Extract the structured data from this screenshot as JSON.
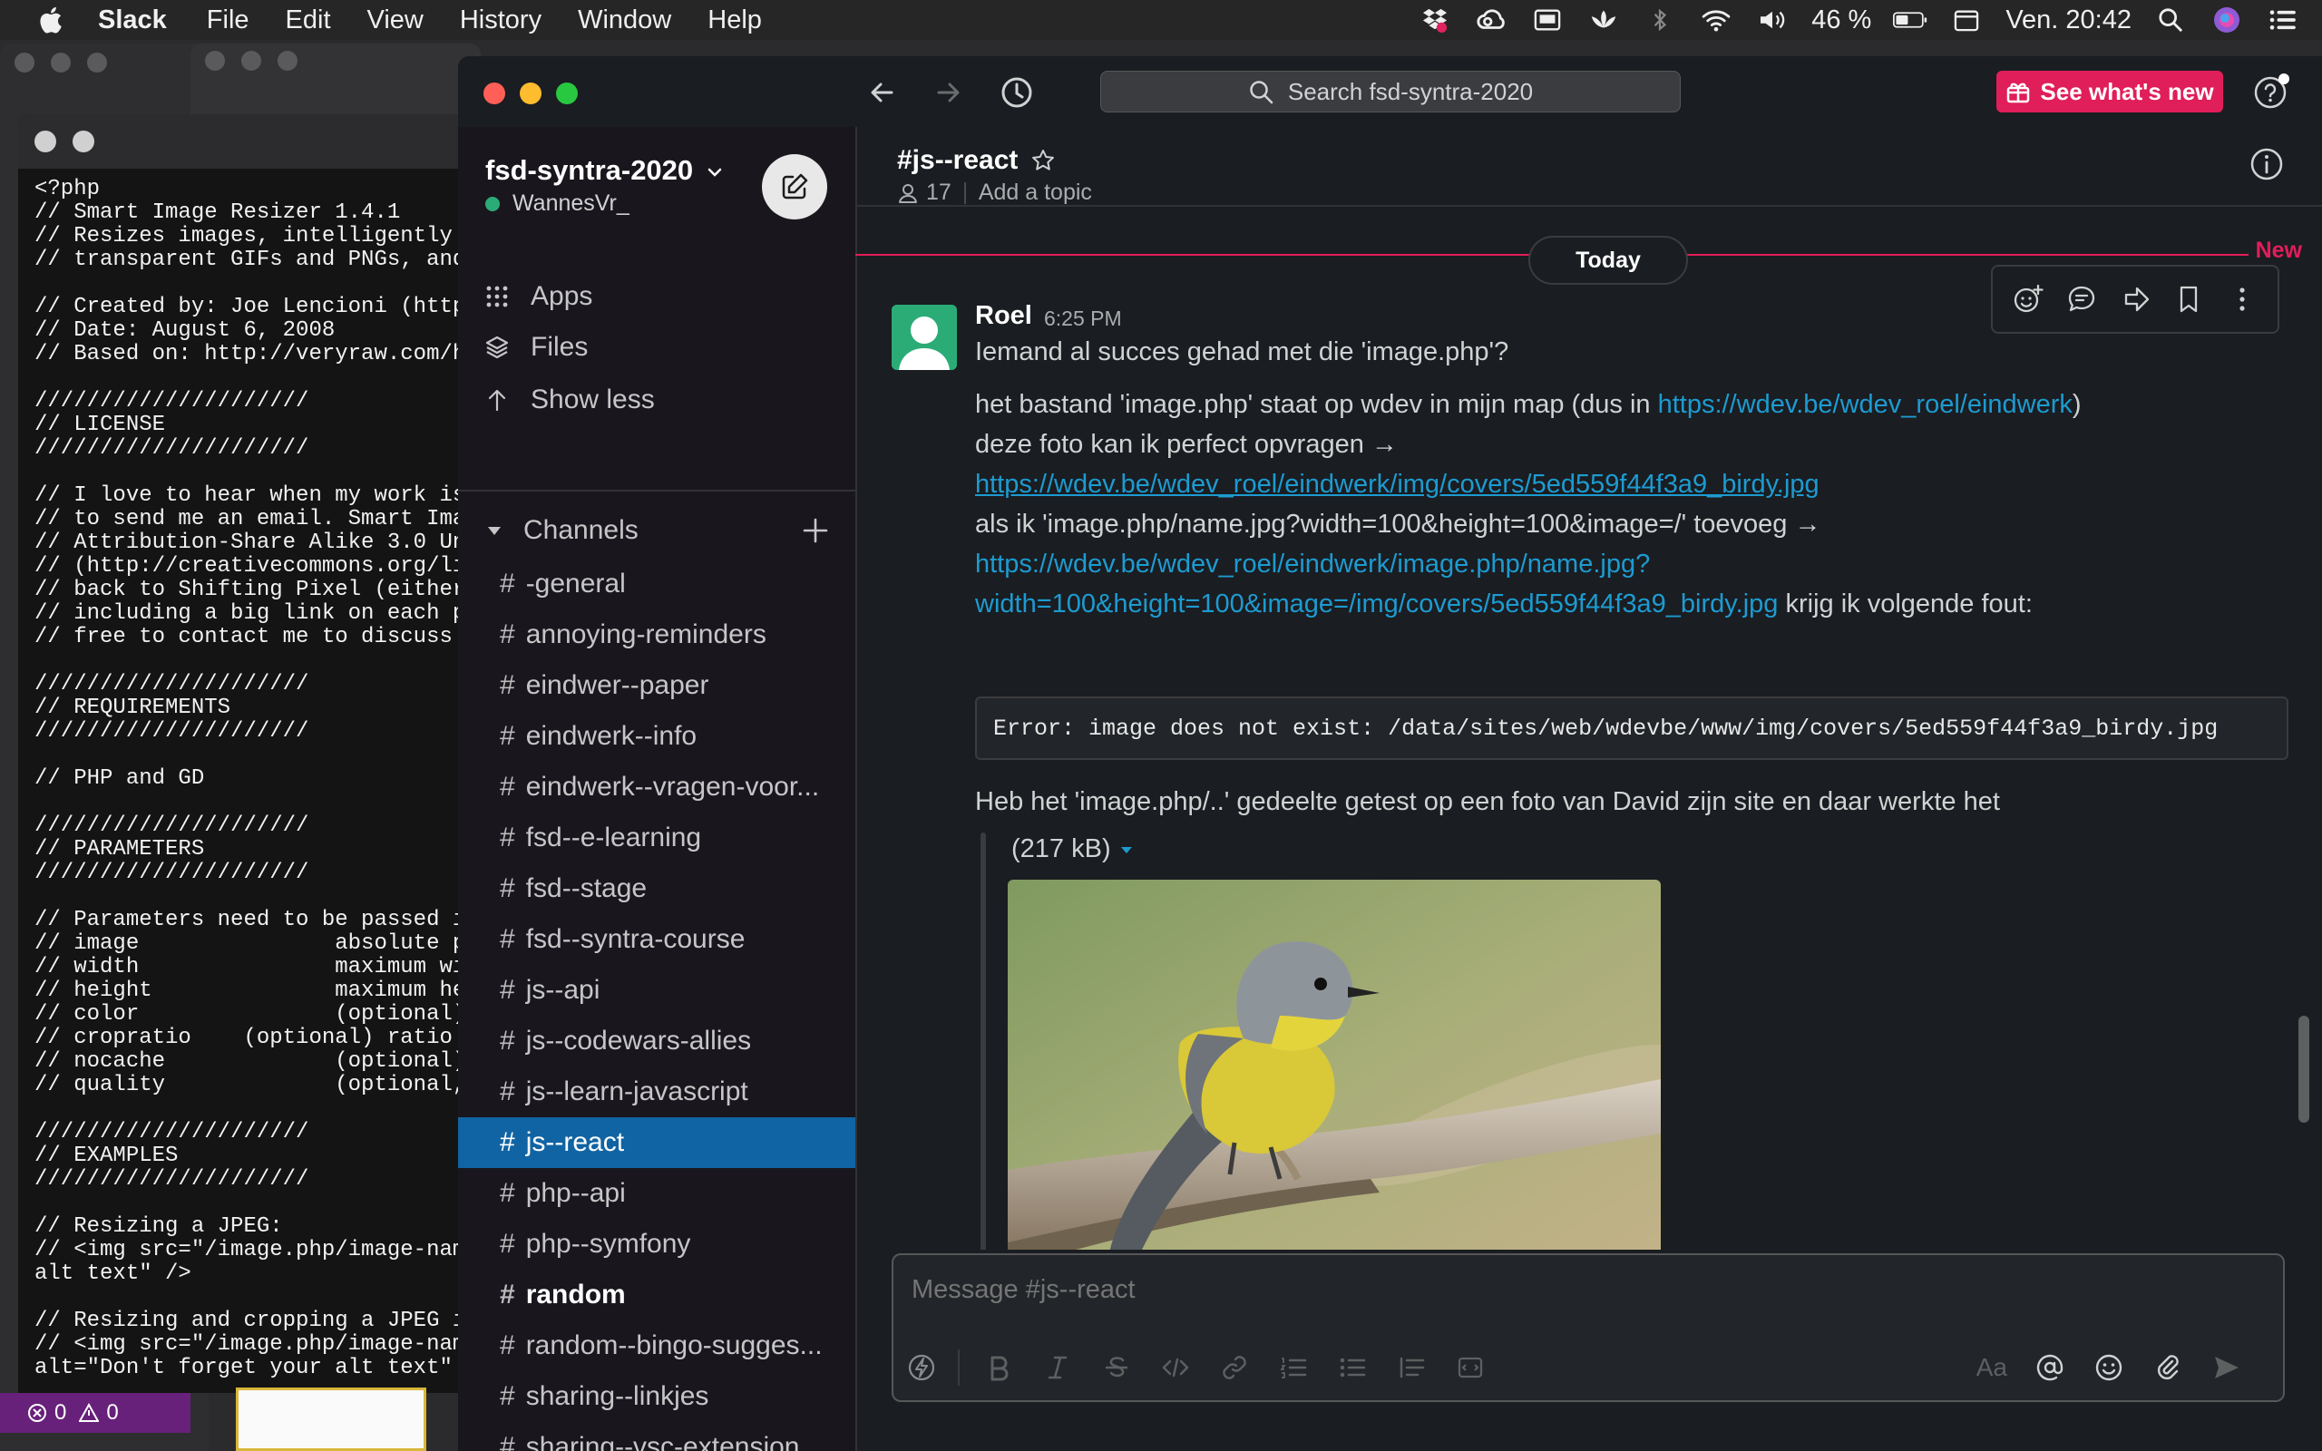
{
  "menubar": {
    "app_name": "Slack",
    "items": [
      "File",
      "Edit",
      "View",
      "History",
      "Window",
      "Help"
    ],
    "battery": "46 %",
    "clock": "Ven. 20:42"
  },
  "code_editor": {
    "code": "<?php\n// Smart Image Resizer 1.4.1\n// Resizes images, intelligently sh\n// transparent GIFs and PNGs, and c\n\n// Created by: Joe Lencioni (http:/\n// Date: August 6, 2008\n// Based on: http://veryraw.com/his\n\n/////////////////////\n// LICENSE\n/////////////////////\n\n// I love to hear when my work is b\n// to send me an email. Smart Image\n// Attribution-Share Alike 3.0 Unit\n// (http://creativecommons.org/lice\n// back to Shifting Pixel (either t\n// including a big link on each pag\n// free to contact me to discuss an\n\n/////////////////////\n// REQUIREMENTS\n/////////////////////\n\n// PHP and GD\n\n/////////////////////\n// PARAMETERS\n/////////////////////\n\n// Parameters need to be passed in \n// image               absolute pa\n// width               maximum wid\n// height              maximum hei\n// color               (optional) \n// cropratio    (optional) ratio of\n// nocache             (optional) \n// quality             (optional, \n\n/////////////////////\n// EXAMPLES\n/////////////////////\n\n// Resizing a JPEG:\n// <img src=\"/image.php/image-name.\nalt text\" />\n\n// Resizing and cropping a JPEG int\n// <img src=\"/image.php/image-name.\nalt=\"Don't forget your alt text\" />",
    "status_errors": "0",
    "status_warnings": "0"
  },
  "toolbar": {
    "search_placeholder": "Search fsd-syntra-2020",
    "whats_new_label": "See what's new"
  },
  "sidebar": {
    "workspace_name": "fsd-syntra-2020",
    "user_name": "WannesVr_",
    "links": [
      {
        "label": "Apps",
        "icon": "apps-grid-icon"
      },
      {
        "label": "Files",
        "icon": "files-layers-icon"
      },
      {
        "label": "Show less",
        "icon": "arrow-up-icon"
      }
    ],
    "channels_label": "Channels",
    "channels": [
      {
        "name": "-general"
      },
      {
        "name": "annoying-reminders"
      },
      {
        "name": "eindwer--paper"
      },
      {
        "name": "eindwerk--info"
      },
      {
        "name": "eindwerk--vragen-voor..."
      },
      {
        "name": "fsd--e-learning"
      },
      {
        "name": "fsd--stage"
      },
      {
        "name": "fsd--syntra-course"
      },
      {
        "name": "js--api"
      },
      {
        "name": "js--codewars-allies"
      },
      {
        "name": "js--learn-javascript"
      },
      {
        "name": "js--react",
        "active": true
      },
      {
        "name": "php--api"
      },
      {
        "name": "php--symfony"
      },
      {
        "name": "random",
        "bold": true
      },
      {
        "name": "random--bingo-sugges..."
      },
      {
        "name": "sharing--linkjes"
      },
      {
        "name": "sharing--vsc-extension"
      }
    ]
  },
  "channel": {
    "name": "#js--react",
    "member_count": "17",
    "topic_placeholder": "Add a topic"
  },
  "messages": {
    "new_label": "New",
    "date_divider": "Today",
    "sender": "Roel",
    "time": "6:25 PM",
    "line1": "Iemand al succes gehad met die 'image.php'?",
    "line2_text": "het bastand 'image.php' staat op wdev in mijn map (dus in ",
    "line2_link": "https://wdev.be/wdev_roel/eindwerk",
    "line2_end": ")",
    "line3": "deze foto kan ik perfect opvragen →",
    "line4_link": "https://wdev.be/wdev_roel/eindwerk/img/covers/5ed559f44f3a9_birdy.jpg",
    "line5": "als ik 'image.php/name.jpg?width=100&height=100&image=/' toevoeg →",
    "line6_link": "https://wdev.be/wdev_roel/eindwerk/image.php/name.jpg?",
    "line7_link": "width=100&height=100&image=/img/covers/5ed559f44f3a9_birdy.jpg",
    "line7_end": " krijg ik volgende fout:",
    "error_code": "Error: image does not exist: /data/sites/web/wdevbe/www/img/covers/5ed559f44f3a9_birdy.jpg",
    "line8": "Heb het 'image.php/..' gedeelte getest op een foto van David zijn site en daar werkte het",
    "file_size": "(217 kB)"
  },
  "composer": {
    "placeholder": "Message #js--react",
    "aa_label": "Aa"
  },
  "colors": {
    "accent_active": "#1164a3",
    "new_marker": "#e01e5a",
    "link": "#1d9bd1",
    "presence": "#2bac76"
  }
}
